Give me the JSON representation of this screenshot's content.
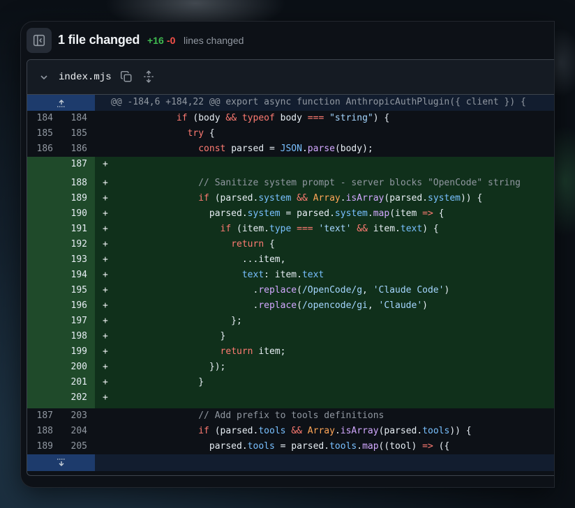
{
  "header": {
    "title": "1 file changed",
    "additions": "+16",
    "deletions": "-0",
    "lines_changed_label": "lines changed"
  },
  "file": {
    "name": "index.mjs",
    "hunk_header": "@@ -184,6 +184,22 @@ export async function AnthropicAuthPlugin({ client }) {"
  },
  "rows": [
    {
      "type": "ctx",
      "old": "184",
      "new": "184",
      "tokens": [
        [
          "",
          "            "
        ],
        [
          "kw",
          "if"
        ],
        [
          "",
          " (body "
        ],
        [
          "op",
          "&&"
        ],
        [
          "",
          " "
        ],
        [
          "kw",
          "typeof"
        ],
        [
          "",
          " body "
        ],
        [
          "op",
          "==="
        ],
        [
          "",
          " "
        ],
        [
          "str",
          "\"string\""
        ],
        [
          "",
          ") {"
        ]
      ]
    },
    {
      "type": "ctx",
      "old": "185",
      "new": "185",
      "tokens": [
        [
          "",
          "              "
        ],
        [
          "kw",
          "try"
        ],
        [
          "",
          " {"
        ]
      ]
    },
    {
      "type": "ctx",
      "old": "186",
      "new": "186",
      "tokens": [
        [
          "",
          "                "
        ],
        [
          "kw",
          "const"
        ],
        [
          "",
          " parsed = "
        ],
        [
          "prop",
          "JSON"
        ],
        [
          "",
          "."
        ],
        [
          "fn",
          "parse"
        ],
        [
          "",
          "(body);"
        ]
      ]
    },
    {
      "type": "add",
      "old": "",
      "new": "187",
      "tokens": []
    },
    {
      "type": "add",
      "old": "",
      "new": "188",
      "tokens": [
        [
          "",
          "                "
        ],
        [
          "cm",
          "// Sanitize system prompt - server blocks \"OpenCode\" string"
        ]
      ]
    },
    {
      "type": "add",
      "old": "",
      "new": "189",
      "tokens": [
        [
          "",
          "                "
        ],
        [
          "kw",
          "if"
        ],
        [
          "",
          " (parsed."
        ],
        [
          "prop",
          "system"
        ],
        [
          "",
          " "
        ],
        [
          "op",
          "&&"
        ],
        [
          "",
          " "
        ],
        [
          "cls",
          "Array"
        ],
        [
          "",
          "."
        ],
        [
          "fn",
          "isArray"
        ],
        [
          "",
          "(parsed."
        ],
        [
          "prop",
          "system"
        ],
        [
          "",
          ")) {"
        ]
      ]
    },
    {
      "type": "add",
      "old": "",
      "new": "190",
      "tokens": [
        [
          "",
          "                  parsed."
        ],
        [
          "prop",
          "system"
        ],
        [
          "",
          " = parsed."
        ],
        [
          "prop",
          "system"
        ],
        [
          "",
          "."
        ],
        [
          "fn",
          "map"
        ],
        [
          "",
          "(item "
        ],
        [
          "op",
          "=>"
        ],
        [
          "",
          " {"
        ]
      ]
    },
    {
      "type": "add",
      "old": "",
      "new": "191",
      "tokens": [
        [
          "",
          "                    "
        ],
        [
          "kw",
          "if"
        ],
        [
          "",
          " (item."
        ],
        [
          "prop",
          "type"
        ],
        [
          "",
          " "
        ],
        [
          "op",
          "==="
        ],
        [
          "",
          " "
        ],
        [
          "str",
          "'text'"
        ],
        [
          "",
          " "
        ],
        [
          "op",
          "&&"
        ],
        [
          "",
          " item."
        ],
        [
          "prop",
          "text"
        ],
        [
          "",
          ") {"
        ]
      ]
    },
    {
      "type": "add",
      "old": "",
      "new": "192",
      "tokens": [
        [
          "",
          "                      "
        ],
        [
          "kw",
          "return"
        ],
        [
          "",
          " {"
        ]
      ]
    },
    {
      "type": "add",
      "old": "",
      "new": "193",
      "tokens": [
        [
          "",
          "                        ...item,"
        ]
      ]
    },
    {
      "type": "add",
      "old": "",
      "new": "194",
      "tokens": [
        [
          "",
          "                        "
        ],
        [
          "prop",
          "text"
        ],
        [
          "",
          ": item."
        ],
        [
          "prop",
          "text"
        ]
      ]
    },
    {
      "type": "add",
      "old": "",
      "new": "195",
      "tokens": [
        [
          "",
          "                          ."
        ],
        [
          "fn",
          "replace"
        ],
        [
          "",
          "("
        ],
        [
          "str",
          "/OpenCode/g"
        ],
        [
          "",
          ", "
        ],
        [
          "str",
          "'Claude Code'"
        ],
        [
          "",
          ")"
        ]
      ]
    },
    {
      "type": "add",
      "old": "",
      "new": "196",
      "tokens": [
        [
          "",
          "                          ."
        ],
        [
          "fn",
          "replace"
        ],
        [
          "",
          "("
        ],
        [
          "str",
          "/opencode/gi"
        ],
        [
          "",
          ", "
        ],
        [
          "str",
          "'Claude'"
        ],
        [
          "",
          ")"
        ]
      ]
    },
    {
      "type": "add",
      "old": "",
      "new": "197",
      "tokens": [
        [
          "",
          "                      };"
        ]
      ]
    },
    {
      "type": "add",
      "old": "",
      "new": "198",
      "tokens": [
        [
          "",
          "                    }"
        ]
      ]
    },
    {
      "type": "add",
      "old": "",
      "new": "199",
      "tokens": [
        [
          "",
          "                    "
        ],
        [
          "kw",
          "return"
        ],
        [
          "",
          " item;"
        ]
      ]
    },
    {
      "type": "add",
      "old": "",
      "new": "200",
      "tokens": [
        [
          "",
          "                  });"
        ]
      ]
    },
    {
      "type": "add",
      "old": "",
      "new": "201",
      "tokens": [
        [
          "",
          "                }"
        ]
      ]
    },
    {
      "type": "add",
      "old": "",
      "new": "202",
      "tokens": []
    },
    {
      "type": "ctx",
      "old": "187",
      "new": "203",
      "tokens": [
        [
          "",
          "                "
        ],
        [
          "cm",
          "// Add prefix to tools definitions"
        ]
      ]
    },
    {
      "type": "ctx",
      "old": "188",
      "new": "204",
      "tokens": [
        [
          "",
          "                "
        ],
        [
          "kw",
          "if"
        ],
        [
          "",
          " (parsed."
        ],
        [
          "prop",
          "tools"
        ],
        [
          "",
          " "
        ],
        [
          "op",
          "&&"
        ],
        [
          "",
          " "
        ],
        [
          "cls",
          "Array"
        ],
        [
          "",
          "."
        ],
        [
          "fn",
          "isArray"
        ],
        [
          "",
          "(parsed."
        ],
        [
          "prop",
          "tools"
        ],
        [
          "",
          ")) {"
        ]
      ]
    },
    {
      "type": "ctx",
      "old": "189",
      "new": "205",
      "tokens": [
        [
          "",
          "                  parsed."
        ],
        [
          "prop",
          "tools"
        ],
        [
          "",
          " = parsed."
        ],
        [
          "prop",
          "tools"
        ],
        [
          "",
          "."
        ],
        [
          "fn",
          "map"
        ],
        [
          "",
          "((tool) "
        ],
        [
          "op",
          "=>"
        ],
        [
          "",
          " ({"
        ]
      ]
    }
  ],
  "colors": {
    "addition": "#3fb950",
    "deletion": "#f85149",
    "added_row_bg": "#10301b",
    "hunk_bg": "#1d3b6c"
  },
  "icons": {
    "sidebar_toggle": "sidebar-collapse-icon",
    "collapse": "chevron-down-icon",
    "copy": "copy-icon",
    "expand_all": "unfold-icon",
    "expand_up": "fold-up-icon",
    "expand_down": "fold-down-icon"
  }
}
